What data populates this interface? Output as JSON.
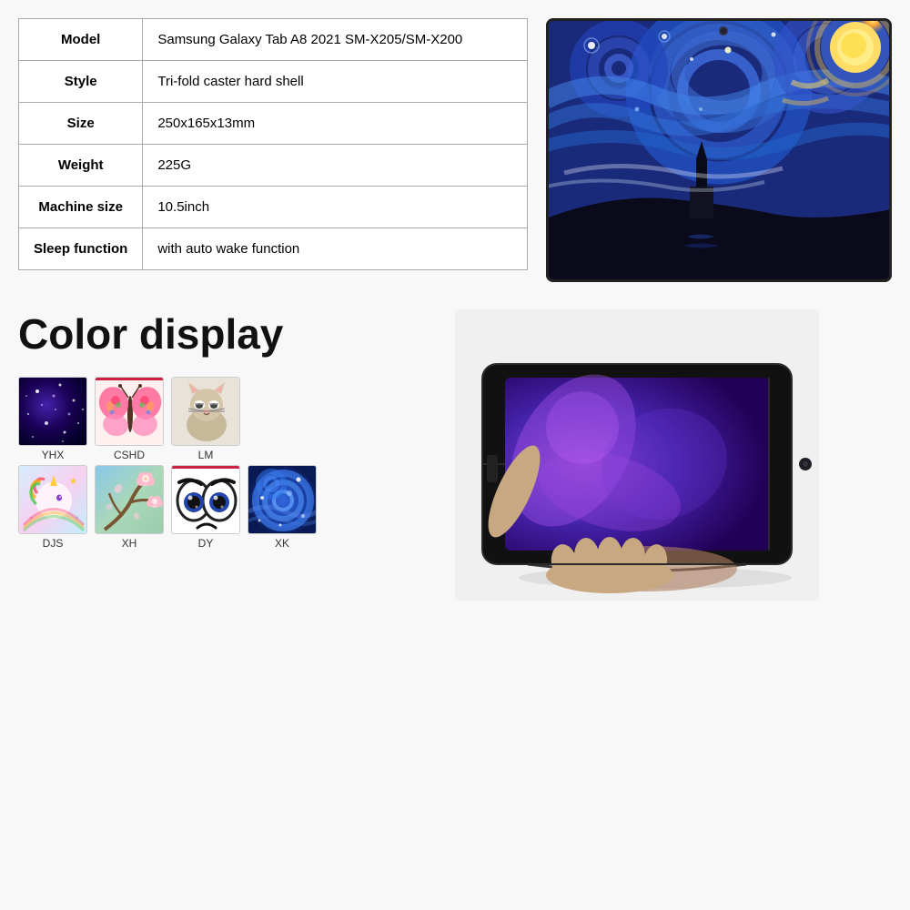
{
  "product": {
    "specs": [
      {
        "label": "Model",
        "value": "Samsung Galaxy Tab A8 2021 SM-X205/SM-X200"
      },
      {
        "label": "Style",
        "value": "Tri-fold caster hard shell"
      },
      {
        "label": "Size",
        "value": "250x165x13mm"
      },
      {
        "label": "Weight",
        "value": "225G"
      },
      {
        "label": "Machine size",
        "value": "10.5inch"
      },
      {
        "label": "Sleep function",
        "value": "with auto wake function"
      }
    ]
  },
  "color_display": {
    "title": "Color display",
    "row1": [
      {
        "id": "YHX",
        "label": "YHX",
        "type": "galaxy"
      },
      {
        "id": "CSHD",
        "label": "CSHD",
        "type": "butterfly"
      },
      {
        "id": "LM",
        "label": "LM",
        "type": "cat"
      }
    ],
    "row2": [
      {
        "id": "DJS",
        "label": "DJS",
        "type": "unicorn"
      },
      {
        "id": "XH",
        "label": "XH",
        "type": "blossom"
      },
      {
        "id": "DY",
        "label": "DY",
        "type": "eyes"
      },
      {
        "id": "XK",
        "label": "XK",
        "type": "swirl"
      }
    ]
  }
}
